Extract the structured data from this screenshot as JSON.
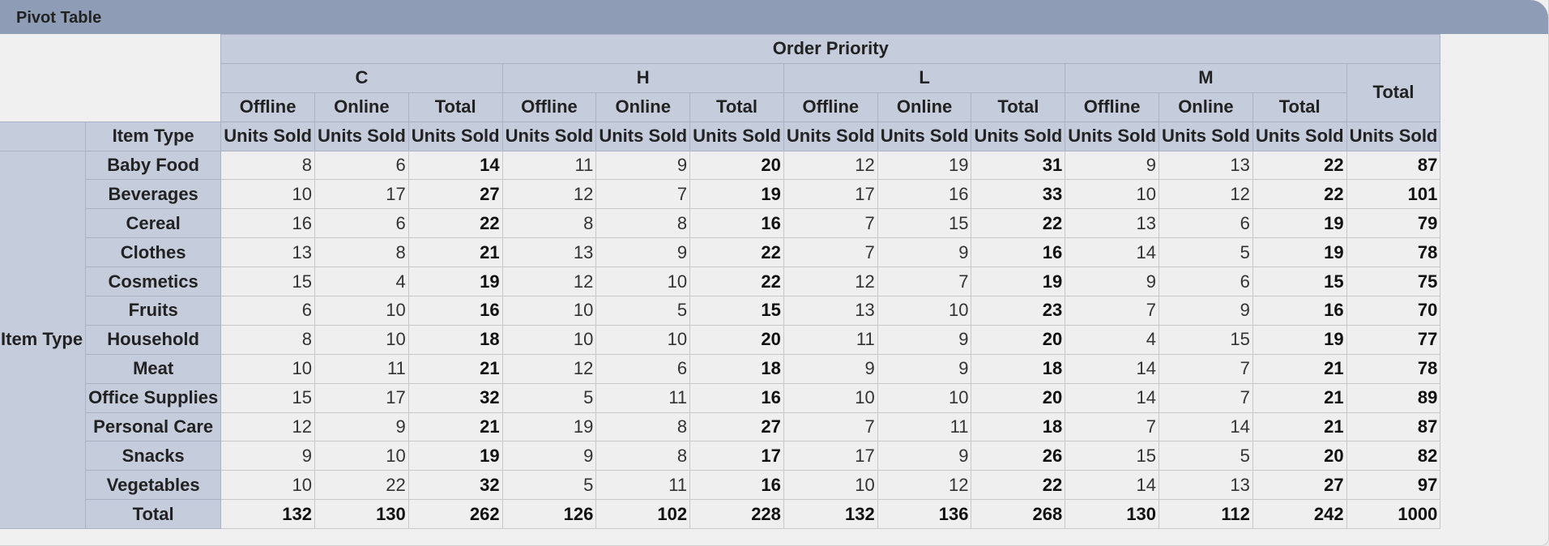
{
  "window": {
    "title": "Pivot Table"
  },
  "pivot": {
    "column_dimension": "Order Priority",
    "row_dimension": "Item Type",
    "priorities": [
      "C",
      "H",
      "L",
      "M"
    ],
    "sub_columns": [
      "Offline",
      "Online",
      "Total"
    ],
    "measure": "Units Sold",
    "grand_total_label": "Total",
    "row_header_label": "Item Type",
    "rows": [
      {
        "label": "Baby Food",
        "values": [
          8,
          6,
          14,
          11,
          9,
          20,
          12,
          19,
          31,
          9,
          13,
          22,
          87
        ]
      },
      {
        "label": "Beverages",
        "values": [
          10,
          17,
          27,
          12,
          7,
          19,
          17,
          16,
          33,
          10,
          12,
          22,
          101
        ]
      },
      {
        "label": "Cereal",
        "values": [
          16,
          6,
          22,
          8,
          8,
          16,
          7,
          15,
          22,
          13,
          6,
          19,
          79
        ]
      },
      {
        "label": "Clothes",
        "values": [
          13,
          8,
          21,
          13,
          9,
          22,
          7,
          9,
          16,
          14,
          5,
          19,
          78
        ]
      },
      {
        "label": "Cosmetics",
        "values": [
          15,
          4,
          19,
          12,
          10,
          22,
          12,
          7,
          19,
          9,
          6,
          15,
          75
        ]
      },
      {
        "label": "Fruits",
        "values": [
          6,
          10,
          16,
          10,
          5,
          15,
          13,
          10,
          23,
          7,
          9,
          16,
          70
        ]
      },
      {
        "label": "Household",
        "values": [
          8,
          10,
          18,
          10,
          10,
          20,
          11,
          9,
          20,
          4,
          15,
          19,
          77
        ]
      },
      {
        "label": "Meat",
        "values": [
          10,
          11,
          21,
          12,
          6,
          18,
          9,
          9,
          18,
          14,
          7,
          21,
          78
        ]
      },
      {
        "label": "Office Supplies",
        "values": [
          15,
          17,
          32,
          5,
          11,
          16,
          10,
          10,
          20,
          14,
          7,
          21,
          89
        ]
      },
      {
        "label": "Personal Care",
        "values": [
          12,
          9,
          21,
          19,
          8,
          27,
          7,
          11,
          18,
          7,
          14,
          21,
          87
        ]
      },
      {
        "label": "Snacks",
        "values": [
          9,
          10,
          19,
          9,
          8,
          17,
          17,
          9,
          26,
          15,
          5,
          20,
          82
        ]
      },
      {
        "label": "Vegetables",
        "values": [
          10,
          22,
          32,
          5,
          11,
          16,
          10,
          12,
          22,
          14,
          13,
          27,
          97
        ]
      }
    ],
    "totals_row": {
      "label": "Total",
      "values": [
        132,
        130,
        262,
        126,
        102,
        228,
        132,
        136,
        268,
        130,
        112,
        242,
        1000
      ]
    }
  }
}
